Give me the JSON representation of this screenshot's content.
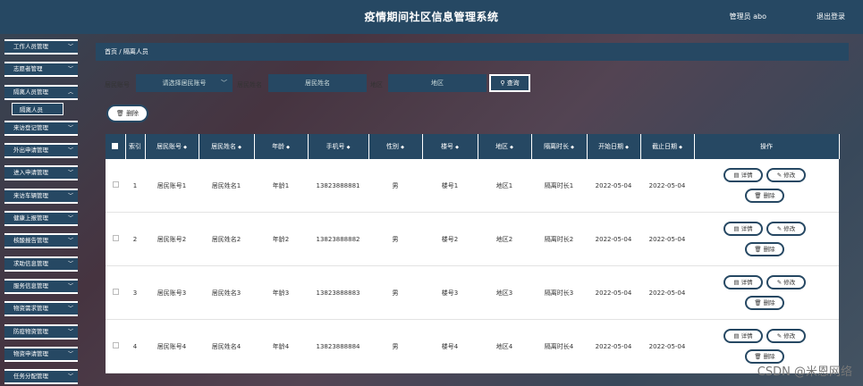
{
  "app": {
    "title": "疫情期间社区信息管理系统",
    "user": "管理员 abo",
    "logout": "退出登录"
  },
  "sidebar": {
    "items": [
      "工作人员管理",
      "志愿者管理",
      "隔离人员管理",
      "来访登记管理",
      "外出申请管理",
      "进入申请管理",
      "来访车辆管理",
      "健康上报管理",
      "核酸报告管理",
      "求助信息管理",
      "服务信息管理",
      "物资需求管理",
      "防疫物资管理",
      "物资申请管理",
      "任务分配管理"
    ],
    "sub_item": "隔离人员"
  },
  "breadcrumb": {
    "home": "首页",
    "sep": "/",
    "current": "隔离人员"
  },
  "filters": {
    "account_label": "居民账号",
    "account_placeholder": "请选择居民账号",
    "name_label": "居民姓名",
    "name_placeholder": "居民姓名",
    "area_label": "地区",
    "area_placeholder": "地区",
    "search_btn": "查询"
  },
  "delete_btn": "删除",
  "table": {
    "headers": [
      "索引",
      "居民账号",
      "居民姓名",
      "年龄",
      "手机号",
      "性别",
      "楼号",
      "地区",
      "隔离时长",
      "开始日期",
      "截止日期",
      "操作"
    ],
    "rows": [
      [
        "1",
        "居民账号1",
        "居民姓名1",
        "年龄1",
        "13823888881",
        "男",
        "楼号1",
        "地区1",
        "隔离时长1",
        "2022-05-04",
        "2022-05-04"
      ],
      [
        "2",
        "居民账号2",
        "居民姓名2",
        "年龄2",
        "13823888882",
        "男",
        "楼号2",
        "地区2",
        "隔离时长2",
        "2022-05-04",
        "2022-05-04"
      ],
      [
        "3",
        "居民账号3",
        "居民姓名3",
        "年龄3",
        "13823888883",
        "男",
        "楼号3",
        "地区3",
        "隔离时长3",
        "2022-05-04",
        "2022-05-04"
      ],
      [
        "4",
        "居民账号4",
        "居民姓名4",
        "年龄4",
        "13823888884",
        "男",
        "楼号4",
        "地区4",
        "隔离时长4",
        "2022-05-04",
        "2022-05-04"
      ]
    ],
    "action_detail": "详情",
    "action_edit": "修改",
    "action_delete": "删除"
  },
  "watermark": "CSDN @米恩网络"
}
